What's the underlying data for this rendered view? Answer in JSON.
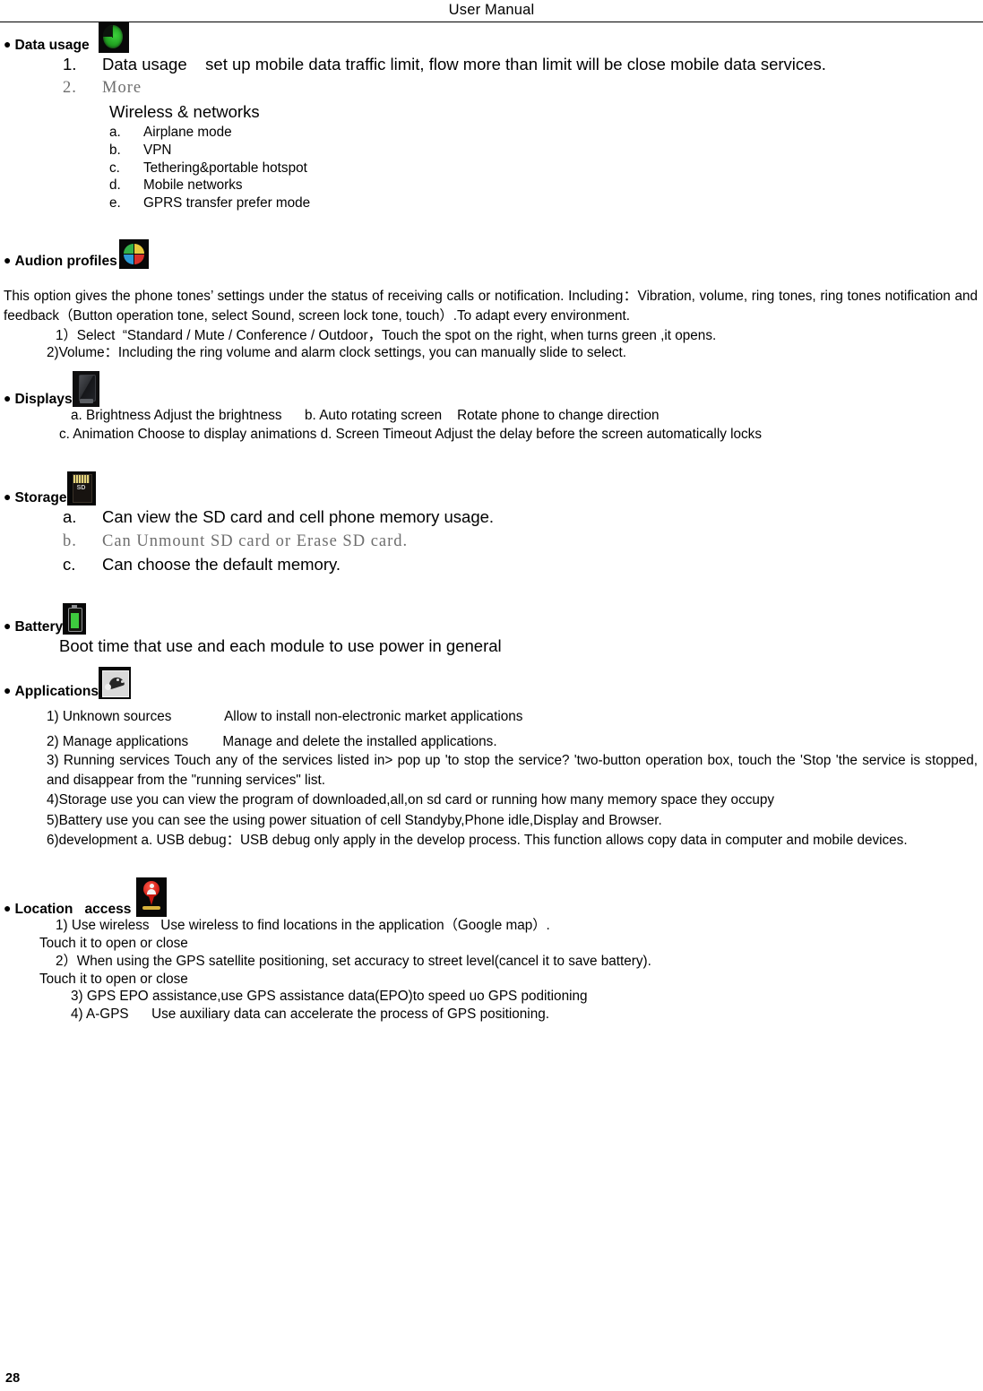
{
  "header": {
    "title": "User  Manual"
  },
  "page_number": "28",
  "sections": {
    "data_usage": {
      "heading": "Data usage",
      "icon": "data-usage-icon",
      "items": [
        {
          "num": "1.",
          "text": "Data usage    set up mobile data traffic limit, flow more than limit will be close mobile data services."
        },
        {
          "num": "2.",
          "text": "More"
        }
      ],
      "subheading": "Wireless & networks",
      "subitems": [
        {
          "num": "a.",
          "text": "Airplane mode"
        },
        {
          "num": "b.",
          "text": "VPN"
        },
        {
          "num": "c.",
          "text": "Tethering&portable hotspot"
        },
        {
          "num": "d.",
          "text": "Mobile networks"
        },
        {
          "num": "e.",
          "text": "GPRS transfer prefer mode"
        }
      ]
    },
    "audio_profiles": {
      "heading": "Audion profiles",
      "icon": "audio-profiles-icon",
      "paragraph": "This option gives the phone tones’ settings under the status of receiving calls or notification. Including：Vibration, volume, ring tones, ring tones notification and feedback（Button operation tone, select Sound, screen lock tone, touch）.To adapt every environment.",
      "items": [
        "1）Select  “Standard / Mute / Conference / Outdoor，Touch the spot on the right, when turns green ,it opens.",
        "2)Volume：Including the ring volume and alarm clock settings, you can manually slide to select."
      ]
    },
    "displays": {
      "heading": "Displays",
      "icon": "display-icon",
      "line1": "a. Brightness Adjust the brightness      b. Auto rotating screen    Rotate phone to change direction",
      "line2": "c. Animation   Choose to display animations   d. Screen Timeout   Adjust the delay before the screen automatically locks"
    },
    "storage": {
      "heading": "Storage",
      "icon": "sd-card-icon",
      "items": [
        {
          "num": "a.",
          "text": "Can view the SD card and cell phone memory usage."
        },
        {
          "num": "b.",
          "text": "Can Unmount SD card or Erase SD card."
        },
        {
          "num": "c.",
          "text": "Can choose the default memory."
        }
      ]
    },
    "battery": {
      "heading": "Battery",
      "icon": "battery-icon",
      "line": "Boot time that use and each module to use power in general"
    },
    "applications": {
      "heading": "Applications",
      "icon": "android-robot-icon",
      "items": [
        "1) Unknown sources              Allow to install non-electronic market applications",
        "2) Manage applications         Manage and delete the installed applications.",
        "3) Running services     Touch any of the services listed in> pop up 'to stop the service? 'two-button operation box, touch the 'Stop 'the service is stopped, and disappear from the \"running services\" list.",
        "4)Storage use        you can view the program of downloaded,all,on sd card or running   how many memory space they occupy",
        "5)Battery use        you can see the using power situation of cell Standyby,Phone idle,Display and Browser.",
        "6)development         a. USB debug：USB debug only apply in the develop process. This function allows copy data in computer and mobile devices."
      ]
    },
    "location_access": {
      "heading": "Location   access",
      "icon": "location-pin-icon",
      "items": [
        "1) Use wireless   Use wireless to find locations in the application（Google map）.",
        "Touch it to open or close",
        "2）When using the GPS satellite positioning, set accuracy to street level(cancel it to save battery).",
        "Touch it to open or close",
        "3) GPS EPO assistance,use GPS assistance data(EPO)to speed uo GPS poditioning",
        "4) A-GPS      Use auxiliary data can accelerate the process of GPS positioning."
      ]
    }
  }
}
